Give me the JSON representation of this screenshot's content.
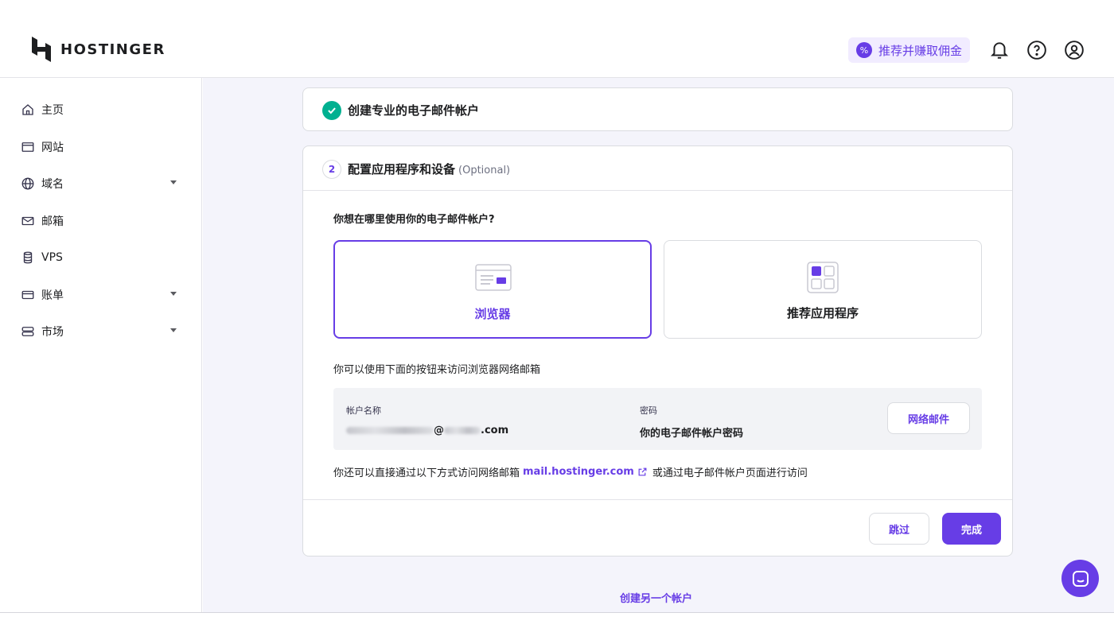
{
  "brand": {
    "name": "HOSTINGER"
  },
  "header": {
    "promo_label": "推荐并赚取佣金",
    "promo_icon": "percent-badge-icon",
    "icons": [
      "bell-icon",
      "help-icon",
      "account-icon"
    ]
  },
  "sidebar": {
    "items": [
      {
        "label": "主页",
        "icon": "home-icon",
        "has_caret": false
      },
      {
        "label": "网站",
        "icon": "window-icon",
        "has_caret": false
      },
      {
        "label": "域名",
        "icon": "globe-icon",
        "has_caret": true
      },
      {
        "label": "邮箱",
        "icon": "mail-icon",
        "has_caret": false
      },
      {
        "label": "VPS",
        "icon": "database-icon",
        "has_caret": false
      },
      {
        "label": "账单",
        "icon": "card-icon",
        "has_caret": true
      },
      {
        "label": "市场",
        "icon": "store-icon",
        "has_caret": true
      }
    ]
  },
  "steps": {
    "step1": {
      "title": "创建专业的电子邮件帐户",
      "status": "done"
    },
    "step2": {
      "number": "2",
      "title": "配置应用程序和设备",
      "optional": "(Optional)",
      "question": "你想在哪里使用你的电子邮件帐户?",
      "options": [
        {
          "label": "浏览器",
          "selected": true
        },
        {
          "label": "推荐应用程序",
          "selected": false
        }
      ],
      "hint": "你可以使用下面的按钮来访问浏览器网络邮箱",
      "account": {
        "name_label": "帐户名称",
        "name_value_at": "@",
        "name_value_tld": ".com",
        "password_label": "密码",
        "password_value": "你的电子邮件帐户密码",
        "webmail_button": "网络邮件"
      },
      "direct": {
        "prefix": "你还可以直接通过以下方式访问网络邮箱",
        "link": "mail.hostinger.com",
        "suffix": "或通过电子邮件帐户页面进行访问"
      },
      "skip_button": "跳过",
      "done_button": "完成"
    }
  },
  "create_another": "创建另一个帐户",
  "colors": {
    "accent": "#673de6",
    "success": "#00b090",
    "background": "#f4f4fb"
  }
}
